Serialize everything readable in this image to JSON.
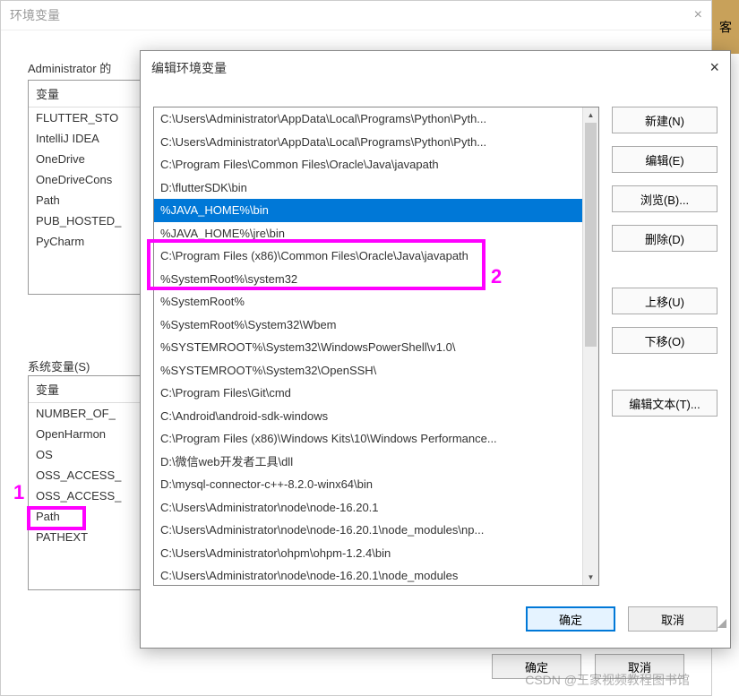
{
  "parent": {
    "title": "环境变量",
    "close": "×",
    "user_label": "Administrator 的",
    "sys_label": "系统变量(S)",
    "col_header": "变量",
    "user_rows": [
      "FLUTTER_STO",
      "IntelliJ IDEA",
      "OneDrive",
      "OneDriveCons",
      "Path",
      "PUB_HOSTED_",
      "PyCharm"
    ],
    "sys_rows": [
      "NUMBER_OF_",
      "OpenHarmon",
      "OS",
      "OSS_ACCESS_",
      "OSS_ACCESS_",
      "Path",
      "PATHEXT"
    ],
    "ok": "确定",
    "cancel": "取消"
  },
  "edit": {
    "title": "编辑环境变量",
    "close": "×",
    "rows": [
      "C:\\Users\\Administrator\\AppData\\Local\\Programs\\Python\\Pyth...",
      "C:\\Users\\Administrator\\AppData\\Local\\Programs\\Python\\Pyth...",
      "C:\\Program Files\\Common Files\\Oracle\\Java\\javapath",
      "D:\\flutterSDK\\bin",
      "%JAVA_HOME%\\bin",
      "%JAVA_HOME%\\jre\\bin",
      "C:\\Program Files (x86)\\Common Files\\Oracle\\Java\\javapath",
      "%SystemRoot%\\system32",
      "%SystemRoot%",
      "%SystemRoot%\\System32\\Wbem",
      "%SYSTEMROOT%\\System32\\WindowsPowerShell\\v1.0\\",
      "%SYSTEMROOT%\\System32\\OpenSSH\\",
      "C:\\Program Files\\Git\\cmd",
      "C:\\Android\\android-sdk-windows",
      "C:\\Program Files (x86)\\Windows Kits\\10\\Windows Performance...",
      "D:\\微信web开发者工具\\dll",
      "D:\\mysql-connector-c++-8.2.0-winx64\\bin",
      "C:\\Users\\Administrator\\node\\node-16.20.1",
      "C:\\Users\\Administrator\\node\\node-16.20.1\\node_modules\\np...",
      "C:\\Users\\Administrator\\ohpm\\ohpm-1.2.4\\bin",
      "C:\\Users\\Administrator\\node\\node-16.20.1\\node_modules"
    ],
    "selected_index": 4,
    "buttons": {
      "new": "新建(N)",
      "edit": "编辑(E)",
      "browse": "浏览(B)...",
      "delete": "删除(D)",
      "up": "上移(U)",
      "down": "下移(O)",
      "edit_text": "编辑文本(T)..."
    },
    "ok": "确定",
    "cancel": "取消"
  },
  "annotations": {
    "label1": "1",
    "label2": "2"
  },
  "gold": "客",
  "watermark": "CSDN @王家视频教程图书馆"
}
